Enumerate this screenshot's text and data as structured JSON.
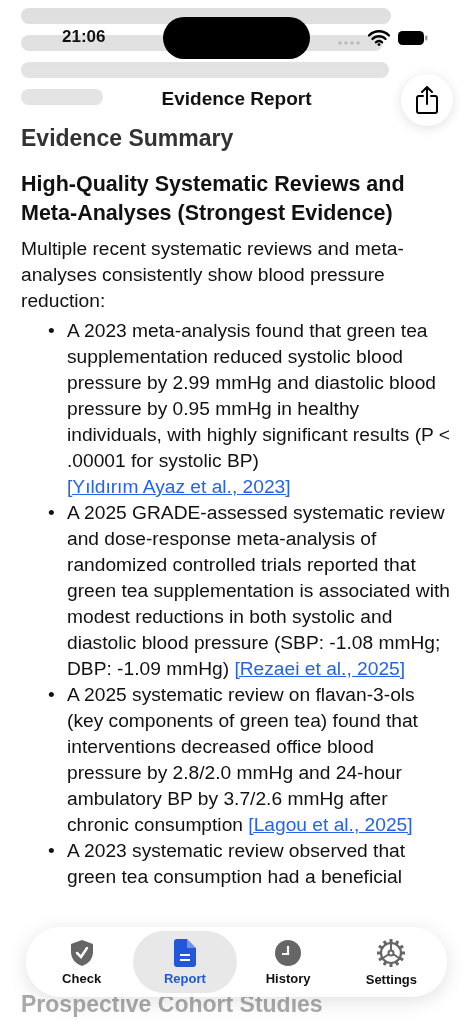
{
  "status_bar": {
    "time": "21:06"
  },
  "nav": {
    "title": "Evidence Report"
  },
  "heading": "Evidence Summary",
  "section": {
    "title": "High-Quality Systematic Reviews and Meta-Analyses (Strongest Evidence)",
    "intro": "Multiple recent systematic reviews and meta-analyses consistently show blood pressure reduction:",
    "bullets": [
      {
        "marker": "•",
        "text": "A 2023 meta-analysis found that green tea supplementation reduced systolic blood pressure by 2.99 mmHg and diastolic blood pressure by 0.95 mmHg in healthy individuals, with highly significant results (P < .00001 for systolic BP)",
        "citation": "[Yıldırım Ayaz et al., 2023]"
      },
      {
        "marker": "•",
        "text": "A 2025 GRADE-assessed systematic review and dose-response meta-analysis of randomized controlled trials reported that green tea supplementation is associated with modest reductions in both systolic and diastolic blood pressure (SBP: -1.08 mmHg; DBP: -1.09 mmHg)",
        "citation": "[Rezaei et al., 2025]"
      },
      {
        "marker": "•",
        "text": "A 2025 systematic review on flavan-3-ols (key components of green tea) found that interventions decreased office blood pressure by 2.8/2.0 mmHg and 24-hour ambulatory BP by 3.7/2.6 mmHg after chronic consumption",
        "citation": "[Lagou et al., 2025]"
      },
      {
        "marker": "•",
        "text": "A 2023 systematic review observed that green tea consumption had a beneficial"
      }
    ]
  },
  "next_heading": "Prospective Cohort Studies",
  "tabs": [
    {
      "kind": "check",
      "label": "Check",
      "selected": false
    },
    {
      "kind": "report",
      "label": "Report",
      "selected": true
    },
    {
      "kind": "history",
      "label": "History",
      "selected": false
    },
    {
      "kind": "settings",
      "label": "Settings",
      "selected": false
    }
  ]
}
